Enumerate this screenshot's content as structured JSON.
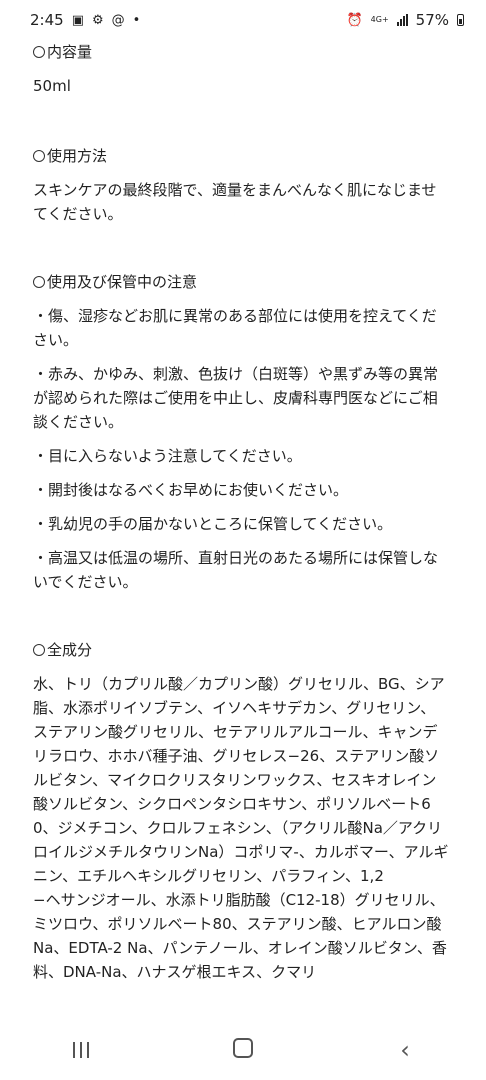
{
  "status_bar": {
    "time": "2:45",
    "network": "4G+",
    "battery": "57%"
  },
  "sections": {
    "volume": {
      "heading": "内容量",
      "body": "50ml"
    },
    "usage": {
      "heading": "使用方法",
      "body": "スキンケアの最終段階で、適量をまんべんなく肌になじませてください。"
    },
    "cautions": {
      "heading": "使用及び保管中の注意",
      "items": [
        "・傷、湿疹などお肌に異常のある部位には使用を控えてください。",
        "・赤み、かゆみ、刺激、色抜け（白斑等）や黒ずみ等の異常が認められた際はご使用を中止し、皮膚科専門医などにご相談ください。",
        "・目に入らないよう注意してください。",
        "・開封後はなるべくお早めにお使いください。",
        "・乳幼児の手の届かないところに保管してください。",
        "・高温又は低温の場所、直射日光のあたる場所には保管しないでください。"
      ]
    },
    "ingredients": {
      "heading": "全成分",
      "body_part1": "水、トリ（カプリル酸／カプリン酸）グリセリル、BG、シア脂、水添ポリイソブテン、イソヘキサデカン、グリセリン、ステアリン酸グリセリル、セテアリルアルコール、キャンデリラロウ、ホホバ種子油、グリセレス−26、ステアリン酸ソルビタン、マイクロクリスタリンワックス、セスキオレイン酸ソルビタン、シクロペンタシロキサン、ポリソルベート60、ジメチコン、クロルフェネシン、（アクリル酸Na／アクリロイルジメチルタウリンNa）コポリマ-、カルボマー、アルギニン、エチルヘキシルグリセリン、パラフィン、1,2",
      "body_part2": "−ヘサンジオール、水添トリ脂肪酸（C12-18）グリセリル、ミツロウ、ポリソルベート80、ステアリン酸、ヒアルロン酸Na、EDTA-2 Na、パンテノール、オレイン酸ソルビタン、香料、DNA-Na、ハナスゲ根エキス、クマリ"
    }
  },
  "nav_bar": {
    "recent_icon": "recent-apps-icon",
    "home_icon": "home-icon",
    "back_icon": "back-icon"
  }
}
